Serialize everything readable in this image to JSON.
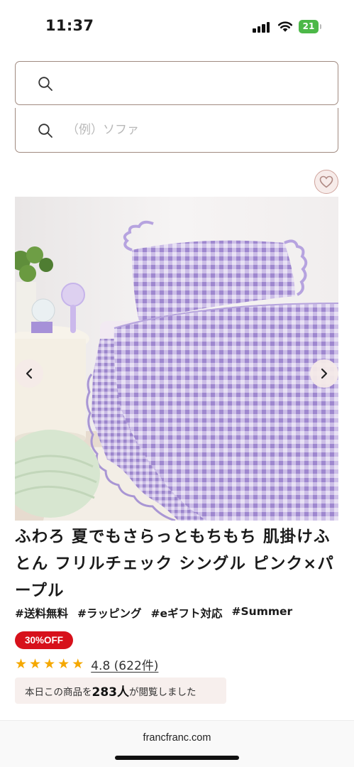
{
  "status_bar": {
    "time": "11:37",
    "battery": "21",
    "icons": [
      "signal-icon",
      "wifi-icon",
      "battery-icon"
    ]
  },
  "search": {
    "primary_value": "",
    "secondary_placeholder": "（例）ソファ",
    "icon": "search-icon"
  },
  "product": {
    "favorite_icon": "heart-icon",
    "image_description_icons": [
      "chevron-left-icon",
      "chevron-right-icon"
    ],
    "title": "ふわろ 夏でもさらっともちもち 肌掛けふとん フリルチェック シングル ピンク×パープル",
    "tags": [
      "#送料無料",
      "#ラッピング",
      "#eギフト対応",
      "#Summer"
    ],
    "discount": "30%OFF",
    "rating": {
      "value": 4.8,
      "max": 5,
      "label": "4.8 (622件)"
    },
    "viewers": {
      "prefix": "本日この商品を",
      "count": "283人",
      "suffix": "が閲覧しました"
    }
  },
  "browser": {
    "url": "francfranc.com"
  },
  "colors": {
    "accent": "#d7111b",
    "border": "#a08a80",
    "star": "#f5a800",
    "battery": "#4cb848",
    "highlight_bg": "#f7efed"
  }
}
